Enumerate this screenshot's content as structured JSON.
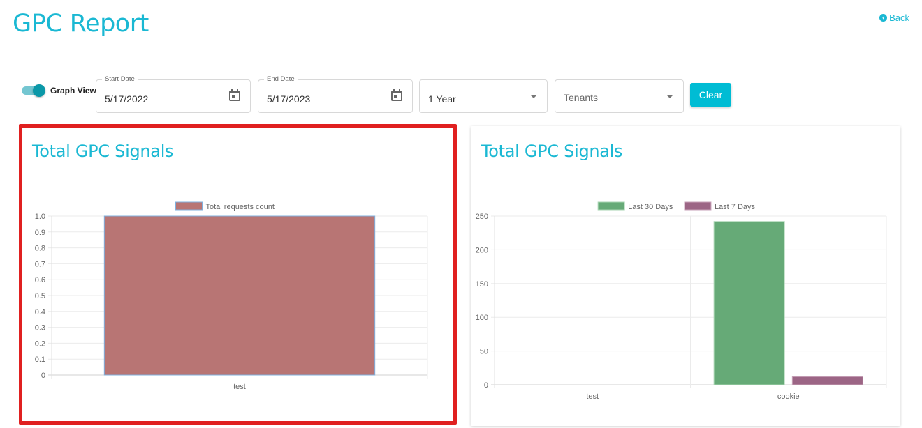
{
  "header": {
    "title": "GPC Report",
    "back_label": "Back"
  },
  "filters": {
    "graph_view_label": "Graph View",
    "graph_view_on": true,
    "start_date": {
      "label": "Start Date",
      "value": "5/17/2022"
    },
    "end_date": {
      "label": "End Date",
      "value": "5/17/2023"
    },
    "period": {
      "value": "1 Year"
    },
    "tenants": {
      "placeholder": "Tenants"
    },
    "clear_label": "Clear"
  },
  "colors": {
    "accent": "#1ab8d3",
    "highlight_border": "#e02020",
    "series_total": "#b87574",
    "series_total_border": "#7fb0de",
    "series_30": "#66aa77",
    "series_7": "#9c6585"
  },
  "chart_data": [
    {
      "type": "bar",
      "title": "Total GPC Signals",
      "categories": [
        "test"
      ],
      "series": [
        {
          "name": "Total requests count",
          "values": [
            1
          ]
        }
      ],
      "xlabel": "",
      "ylabel": "",
      "ylim": [
        0,
        1.0
      ],
      "yticks": [
        "0",
        "0.1",
        "0.2",
        "0.3",
        "0.4",
        "0.5",
        "0.6",
        "0.7",
        "0.8",
        "0.9",
        "1.0"
      ],
      "grid": true,
      "legend": "top-center"
    },
    {
      "type": "bar",
      "title": "Total GPC Signals",
      "categories": [
        "test",
        "cookie"
      ],
      "series": [
        {
          "name": "Last 30 Days",
          "values": [
            0,
            242
          ]
        },
        {
          "name": "Last 7 Days",
          "values": [
            0,
            12
          ]
        }
      ],
      "xlabel": "",
      "ylabel": "",
      "ylim": [
        0,
        250
      ],
      "yticks": [
        "0",
        "50",
        "100",
        "150",
        "200",
        "250"
      ],
      "grid": true,
      "legend": "top-center"
    }
  ]
}
